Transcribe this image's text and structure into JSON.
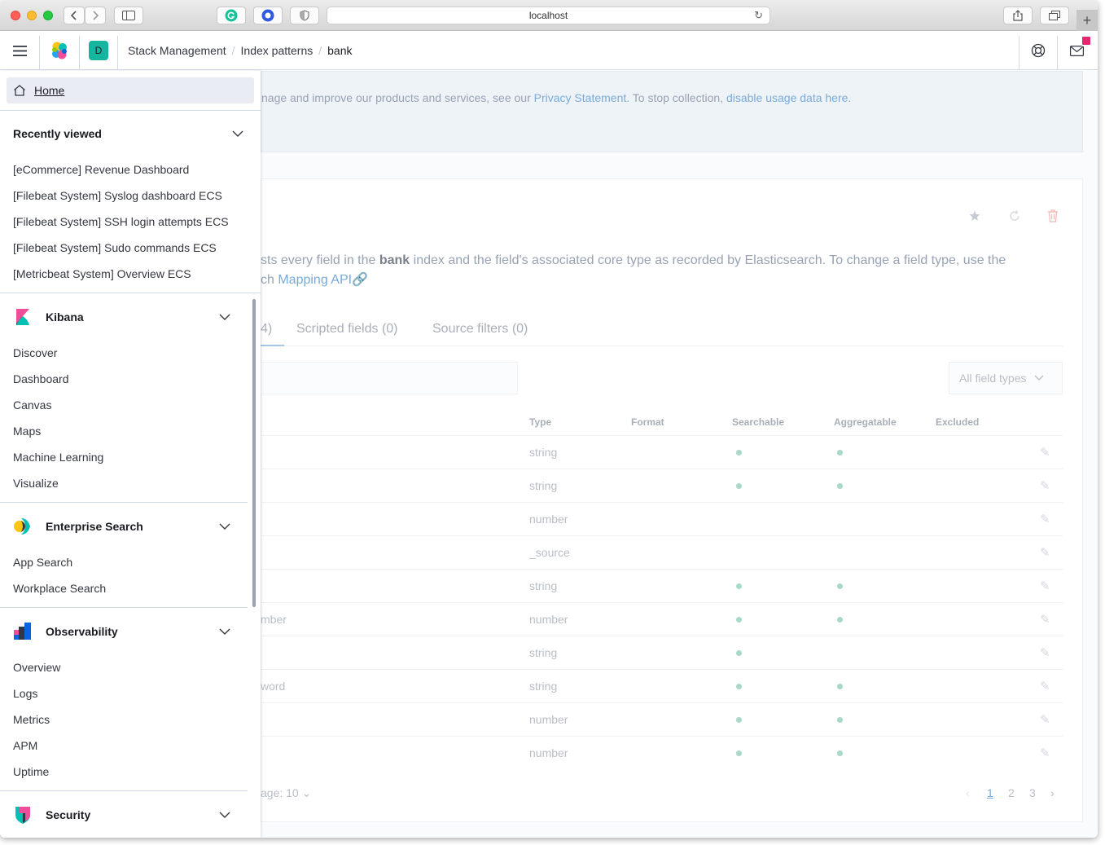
{
  "browser": {
    "url": "localhost"
  },
  "header": {
    "space_initial": "D",
    "breadcrumbs": [
      "Stack Management",
      "Index patterns",
      "bank"
    ]
  },
  "background": {
    "callout_text_1": "nage and improve our products and services, see our ",
    "callout_link_1": "Privacy Statement",
    "callout_text_2": ". To stop collection, ",
    "callout_link_2": "disable usage data here",
    "callout_text_3": ".",
    "desc_line1_a": "sts every field in the ",
    "desc_bold": "bank",
    "desc_line1_b": " index and the field's associated core type as recorded by Elasticsearch. To change a field type, use the",
    "desc_line2_a": "ch ",
    "desc_link": "Mapping API",
    "tabs": [
      "4)",
      "Scripted fields (0)",
      "Source filters (0)"
    ],
    "field_type_select": "All field types",
    "columns": [
      "Type",
      "Format",
      "Searchable",
      "Aggregatable",
      "Excluded"
    ],
    "rows": [
      {
        "name": "",
        "type": "string",
        "searchable": true,
        "aggregatable": true
      },
      {
        "name": "",
        "type": "string",
        "searchable": true,
        "aggregatable": true
      },
      {
        "name": "",
        "type": "number",
        "searchable": false,
        "aggregatable": false
      },
      {
        "name": "",
        "type": "_source",
        "searchable": false,
        "aggregatable": false
      },
      {
        "name": "",
        "type": "string",
        "searchable": true,
        "aggregatable": true
      },
      {
        "name": "mber",
        "type": "number",
        "searchable": true,
        "aggregatable": true
      },
      {
        "name": "",
        "type": "string",
        "searchable": true,
        "aggregatable": false
      },
      {
        "name": "word",
        "type": "string",
        "searchable": true,
        "aggregatable": true
      },
      {
        "name": "",
        "type": "number",
        "searchable": true,
        "aggregatable": true
      },
      {
        "name": "",
        "type": "number",
        "searchable": true,
        "aggregatable": true
      }
    ],
    "rows_per_page": "age: 10",
    "pages": [
      "1",
      "2",
      "3"
    ]
  },
  "nav": {
    "home": "Home",
    "recently_viewed": {
      "title": "Recently viewed",
      "items": [
        "[eCommerce] Revenue Dashboard",
        "[Filebeat System] Syslog dashboard ECS",
        "[Filebeat System] SSH login attempts ECS",
        "[Filebeat System] Sudo commands ECS",
        "[Metricbeat System] Overview ECS"
      ]
    },
    "kibana": {
      "title": "Kibana",
      "items": [
        "Discover",
        "Dashboard",
        "Canvas",
        "Maps",
        "Machine Learning",
        "Visualize"
      ]
    },
    "enterprise_search": {
      "title": "Enterprise Search",
      "items": [
        "App Search",
        "Workplace Search"
      ]
    },
    "observability": {
      "title": "Observability",
      "items": [
        "Overview",
        "Logs",
        "Metrics",
        "APM",
        "Uptime"
      ]
    },
    "security": {
      "title": "Security"
    }
  }
}
